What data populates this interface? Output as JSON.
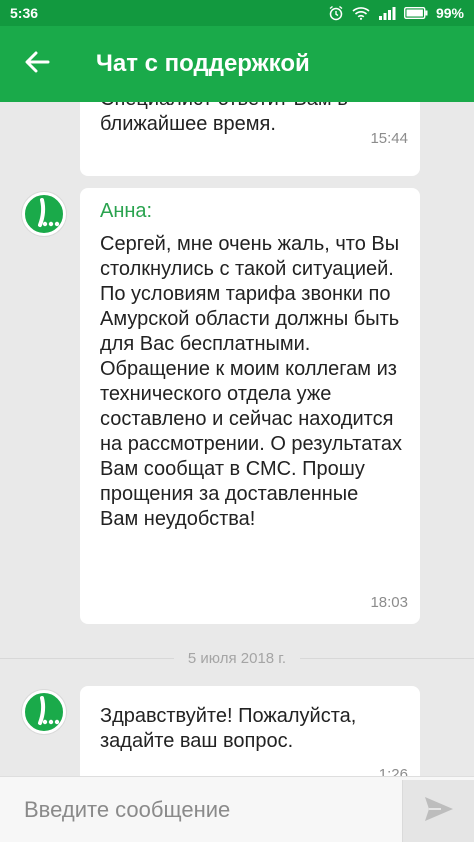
{
  "status_bar": {
    "time": "5:36",
    "battery": "99%",
    "icons": [
      "alarm-icon",
      "wifi-icon",
      "signal-icon",
      "battery-icon"
    ]
  },
  "app_bar": {
    "title": "Чат с поддержкой",
    "back_icon": "arrow-left-icon",
    "color": "#1aaa4a"
  },
  "messages": [
    {
      "text": "Специалист ответит Вам в ближайшее время.",
      "time": "15:44"
    },
    {
      "sender": "Анна:",
      "text": "Сергей, мне очень жаль, что Вы столкнулись с такой ситуацией. По условиям тарифа звонки по Амурской области должны быть для Вас бесплатными. Обращение к моим коллегам из технического отдела уже составлено и сейчас находится на рассмотрении. О результатах Вам сообщат в СМС. Прошу прощения за доставленные Вам неудобства!",
      "time": "18:03"
    },
    {
      "text": "Здравствуйте! Пожалуйста, задайте ваш вопрос.",
      "time": "1:26"
    }
  ],
  "date_separator": "5 июля 2018 г.",
  "composer": {
    "placeholder": "Введите сообщение",
    "send_icon": "send-icon"
  }
}
